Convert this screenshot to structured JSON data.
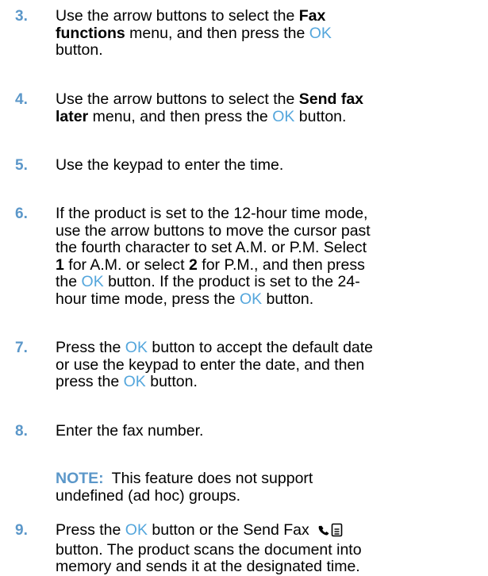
{
  "steps": [
    {
      "number": "3.",
      "parts": [
        "Use the arrow buttons to select the ",
        "Fax",
        "functions",
        " menu, and then press the ",
        "OK",
        "button."
      ]
    },
    {
      "number": "4.",
      "parts": [
        "Use the arrow buttons to select the ",
        "Send fax",
        "later",
        " menu, and then press the ",
        "OK",
        " button."
      ]
    },
    {
      "number": "5.",
      "parts": [
        "Use the keypad to enter the time."
      ]
    },
    {
      "number": "6.",
      "parts": [
        "If the product is set to the 12-hour time mode,",
        "use the arrow buttons to move the cursor past",
        "the fourth character to set A.M. or P.M. Select",
        "1",
        " for A.M. or select ",
        "2",
        " for P.M., and then press",
        "the ",
        "OK",
        " button. If the product is set to the 24-",
        "hour time mode, press the ",
        "OK",
        " button."
      ]
    },
    {
      "number": "7.",
      "parts": [
        "Press the ",
        "OK",
        " button to accept the default date",
        "or use the keypad to enter the date, and then",
        "press the ",
        "OK",
        " button."
      ]
    },
    {
      "number": "8.",
      "parts": [
        "Enter the fax number."
      ]
    },
    {
      "note_label": "NOTE:",
      "parts": [
        "This feature does not support",
        "undefined (ad hoc) groups."
      ]
    },
    {
      "number": "9.",
      "parts": [
        "Press the ",
        "OK",
        " button or the Send Fax ",
        "button. The product scans the document into",
        "memory and sends it at the designated time."
      ],
      "icon": "send-fax-icon"
    }
  ],
  "colors": {
    "step_number": "#5b97c9",
    "ok_text": "#54a6dc",
    "text": "#000000"
  }
}
